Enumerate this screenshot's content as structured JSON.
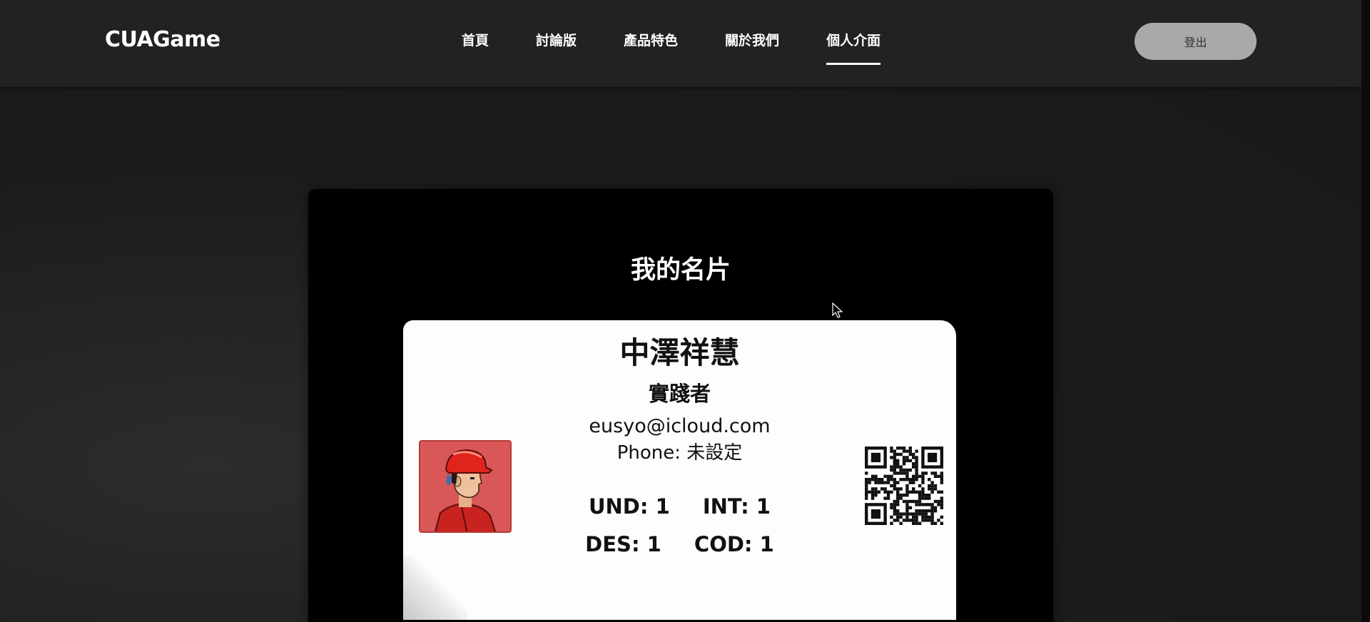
{
  "header": {
    "logo": "CUAGame",
    "nav": [
      {
        "label": "首頁"
      },
      {
        "label": "討論版"
      },
      {
        "label": "產品特色"
      },
      {
        "label": "關於我們"
      },
      {
        "label": "個人介面",
        "active": true
      }
    ],
    "logout_label": "登出"
  },
  "panel": {
    "title": "我的名片"
  },
  "card": {
    "name": "中澤祥慧",
    "role": "實踐者",
    "email": "eusyo@icloud.com",
    "phone": "Phone: 未設定",
    "stats": {
      "und": "UND: 1",
      "int": "INT: 1",
      "des": "DES: 1",
      "cod": "COD: 1"
    }
  },
  "colors": {
    "header_bg": "#222222",
    "panel_bg": "#000000",
    "card_bg": "#fdfdfd",
    "logout_bg": "#a9a9a9",
    "avatar_bg": "#d95757"
  },
  "icons": {
    "avatar": "worker-avatar-icon",
    "qr": "qr-code-icon",
    "cursor": "mouse-pointer-icon"
  }
}
